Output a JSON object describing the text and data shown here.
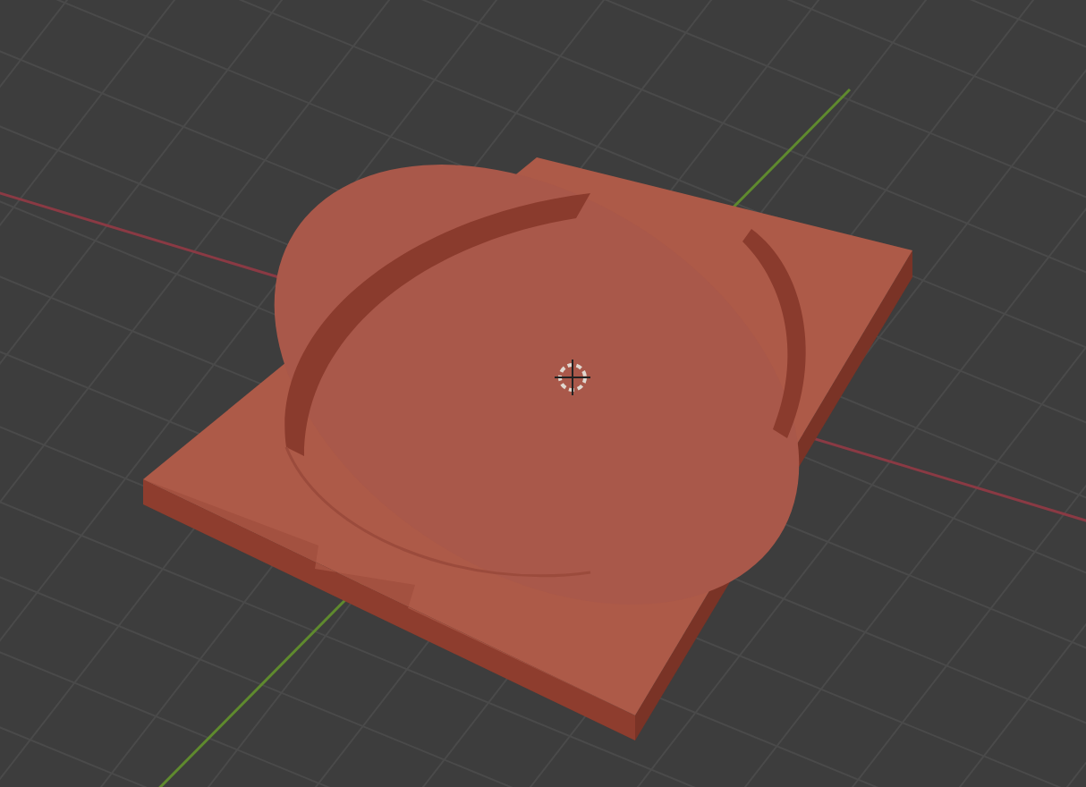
{
  "viewport": {
    "axes": [
      {
        "kind": "x",
        "color": "#8a3a44"
      },
      {
        "kind": "y",
        "color": "#5f8a2e"
      }
    ]
  }
}
